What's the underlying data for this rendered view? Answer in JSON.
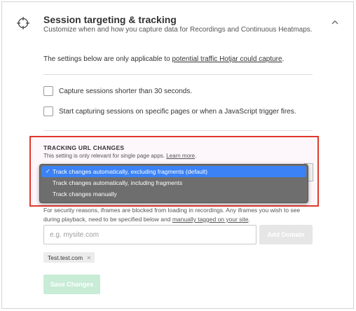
{
  "section": {
    "title": "Session targeting & tracking",
    "subtitle": "Customize when and how you capture data for Recordings and Continuous Heatmaps.",
    "icon": "crosshair-icon",
    "collapse_icon": "chevron-up-icon"
  },
  "info": {
    "prefix": "The settings below are only applicable to ",
    "link": "potential traffic Hotjar could capture",
    "suffix": "."
  },
  "options": [
    {
      "label": "Capture sessions shorter than 30 seconds.",
      "checked": false
    },
    {
      "label": "Start capturing sessions on specific pages or when a JavaScript trigger fires.",
      "checked": false
    }
  ],
  "tracking": {
    "label": "TRACKING URL CHANGES",
    "hint": "This setting is only relevant for single page apps. ",
    "hint_link": "Learn more",
    "hint_suffix": ".",
    "dropdown": [
      {
        "label": "Track changes automatically, excluding fragments (default)",
        "selected": true
      },
      {
        "label": "Track changes automatically, including fragments",
        "selected": false
      },
      {
        "label": "Track changes manually",
        "selected": false
      }
    ]
  },
  "security": {
    "text": "For security reasons, iframes are blocked from loading in recordings. Any iframes you wish to see during playback, need to be specified below and ",
    "link": "manually tagged on your site",
    "suffix": "."
  },
  "domain": {
    "placeholder": "e.g. mysite.com",
    "add_label": "Add Domain",
    "chips": [
      {
        "label": "Test.test.com"
      }
    ]
  },
  "save_label": "Save Changes",
  "colors": {
    "highlight_border": "#e0392d",
    "selected_option": "#3b82f6",
    "save_button": "#c8ecd6"
  }
}
